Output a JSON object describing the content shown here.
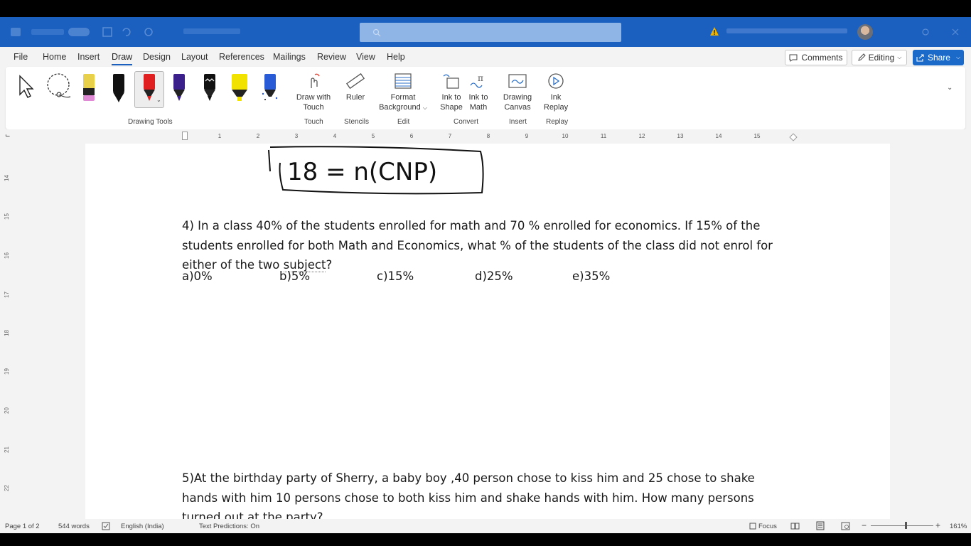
{
  "titlebar": {
    "search_placeholder": "Search",
    "doc_title": "Saved",
    "user_text": ""
  },
  "menu": {
    "tabs": [
      "File",
      "Home",
      "Insert",
      "Draw",
      "Design",
      "Layout",
      "References",
      "Mailings",
      "Review",
      "View",
      "Help"
    ],
    "active_tab": "Draw",
    "comments_label": "Comments",
    "editing_label": "Editing",
    "share_label": "Share"
  },
  "ribbon": {
    "draw_with_touch": [
      "Draw with",
      "Touch"
    ],
    "ruler": "Ruler",
    "format_background": [
      "Format",
      "Background"
    ],
    "ink_to_shape": [
      "Ink to",
      "Shape"
    ],
    "ink_to_math": [
      "Ink to",
      "Math"
    ],
    "drawing_canvas": [
      "Drawing",
      "Canvas"
    ],
    "ink_replay": [
      "Ink",
      "Replay"
    ],
    "groups": {
      "drawing_tools": "Drawing Tools",
      "touch": "Touch",
      "stencils": "Stencils",
      "edit": "Edit",
      "convert": "Convert",
      "insert": "Insert",
      "replay": "Replay"
    },
    "pen_colors": [
      "#e8d04a",
      "#111111",
      "#e02020",
      "#3b1f8a",
      "#111111",
      "#f2e200",
      "#2a5bd7"
    ]
  },
  "ruler": {
    "h_numbers": [
      "1",
      "2",
      "3",
      "4",
      "5",
      "6",
      "7",
      "8",
      "9",
      "10",
      "11",
      "12",
      "13",
      "14",
      "15"
    ],
    "v_numbers": [
      "14",
      "15",
      "16",
      "17",
      "18",
      "19",
      "20",
      "21",
      "22"
    ]
  },
  "document": {
    "handwriting": "18 = n(CNP)",
    "q4_line1": "4) In a class 40% of the students enrolled for math and 70 % enrolled for economics. If 15% of the",
    "q4_line2": "students enrolled for both Math and Economics, what % of the students of the class did not enrol for",
    "q4_line3_pre": "either of the two ",
    "q4_line3_word": "subject",
    "q4_line3_post": "?",
    "options": [
      "a)0%",
      "b)5%",
      "c)15%",
      "d)25%",
      "e)35%"
    ],
    "q5_line1": "5)At the birthday party of Sherry, a baby boy ,40 person chose to kiss him and 25 chose to shake",
    "q5_line2": "hands with him 10 persons chose to both kiss him and shake hands with him. How many persons",
    "q5_line3": "turned out at the party?"
  },
  "status": {
    "page": "Page 1 of 2",
    "words": "544 words",
    "language": "English (India)",
    "predictions": "Text Predictions: On",
    "focus": "Focus",
    "zoom": "161%"
  }
}
